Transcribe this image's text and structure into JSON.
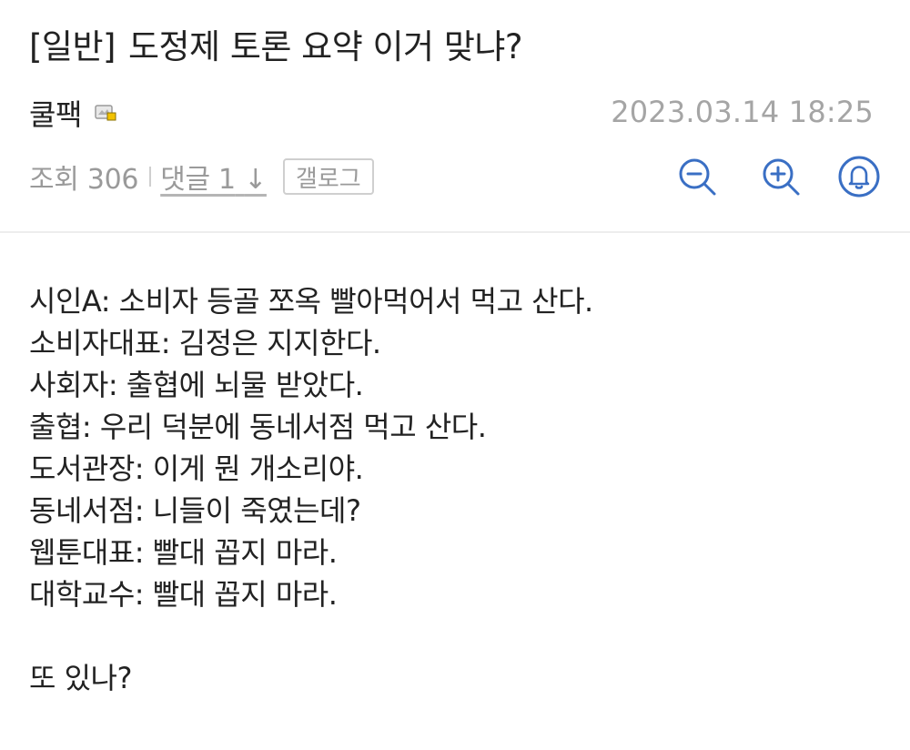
{
  "post": {
    "category": "[일반]",
    "title": "도정제 토론 요약 이거 맞냐?",
    "author": "쿨팩",
    "date": "2023.03.14 18:25",
    "views_label": "조회 306",
    "comments_label": "댓글 1",
    "comments_arrow": "↓",
    "gallery_label": "갤로그"
  },
  "toolbar": {
    "zoom_out_icon": "zoom-out-icon",
    "zoom_in_icon": "zoom-in-icon",
    "notify_icon": "bell-icon",
    "icon_color": "#3a6fc4"
  },
  "body": {
    "lines": [
      "시인A: 소비자 등골 쪼옥 빨아먹어서 먹고 산다.",
      "소비자대표: 김정은 지지한다.",
      "사회자: 출협에 뇌물 받았다.",
      "출협: 우리 덕분에 동네서점 먹고 산다.",
      "도서관장: 이게 뭔 개소리야.",
      "동네서점: 니들이 죽였는데?",
      "웹툰대표: 빨대 꼽지 마라.",
      "대학교수: 빨대 꼽지 마라."
    ],
    "closing": "또 있나?"
  }
}
